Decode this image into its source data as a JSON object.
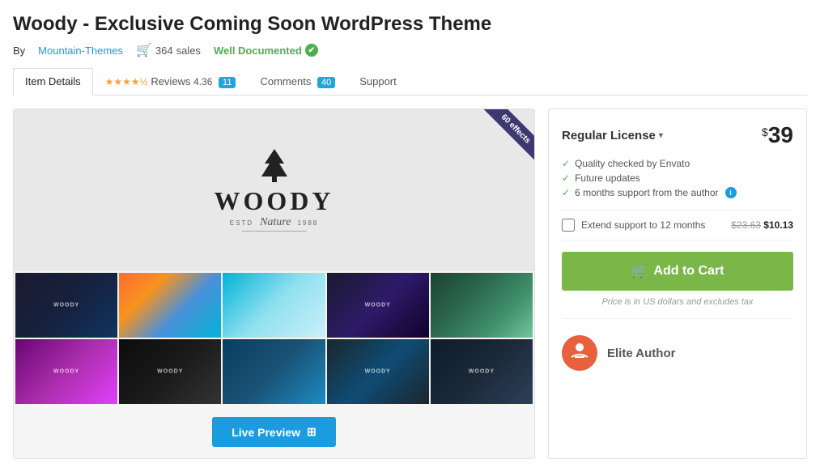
{
  "page": {
    "title": "Woody - Exclusive Coming Soon WordPress Theme",
    "author": {
      "label": "By",
      "name": "Mountain-Themes"
    },
    "sales": {
      "icon": "🛒",
      "count": "364",
      "label": "sales"
    },
    "well_documented": {
      "text": "Well Documented",
      "check": "✔"
    }
  },
  "tabs": [
    {
      "label": "Item Details",
      "active": true,
      "badge": null
    },
    {
      "label": "Reviews",
      "active": false,
      "stars": "★★★★½",
      "rating": "4.36",
      "badge": "11"
    },
    {
      "label": "Comments",
      "active": false,
      "badge": "40"
    },
    {
      "label": "Support",
      "active": false,
      "badge": null
    }
  ],
  "preview": {
    "ribbon": {
      "line1": "60 effects"
    },
    "woody_logo": {
      "estd": "ESTD",
      "name": "WOODY",
      "italic": "Nature",
      "year": "1988"
    },
    "thumbnails": [
      {
        "id": 1,
        "label": "WOODY",
        "class": "t1"
      },
      {
        "id": 2,
        "label": "",
        "class": "t2"
      },
      {
        "id": 3,
        "label": "",
        "class": "t3"
      },
      {
        "id": 4,
        "label": "WOODY",
        "class": "t4"
      },
      {
        "id": 5,
        "label": "",
        "class": "t5"
      },
      {
        "id": 6,
        "label": "WOODY",
        "class": "t6"
      },
      {
        "id": 7,
        "label": "WOODY",
        "class": "t7"
      },
      {
        "id": 8,
        "label": "",
        "class": "t8"
      },
      {
        "id": 9,
        "label": "WOODY",
        "class": "t9"
      },
      {
        "id": 10,
        "label": "WOODY",
        "class": "t10"
      }
    ],
    "live_preview_btn": "Live Preview",
    "grid_icon": "⊞"
  },
  "purchase": {
    "license_label": "Regular License",
    "dropdown_icon": "▾",
    "currency_symbol": "$",
    "price": "39",
    "features": [
      {
        "text": "Quality checked by Envato",
        "has_info": false
      },
      {
        "text": "Future updates",
        "has_info": false
      },
      {
        "text": "6 months support from the author",
        "has_info": true
      }
    ],
    "extend_support": {
      "label": "Extend support to 12 months",
      "original_price": "$23.63",
      "discounted_price": "$10.13"
    },
    "add_to_cart_label": "Add to Cart",
    "cart_icon": "🛒",
    "price_note": "Price is in US dollars and excludes tax",
    "elite_author": {
      "badge_icon": "≡",
      "label": "Elite Author"
    }
  },
  "colors": {
    "accent_blue": "#1b9be0",
    "accent_green": "#7ab648",
    "accent_orange": "#e8603c",
    "star_yellow": "#f5a623",
    "doc_green": "#4caf50",
    "ribbon_purple": "#3d3870"
  }
}
